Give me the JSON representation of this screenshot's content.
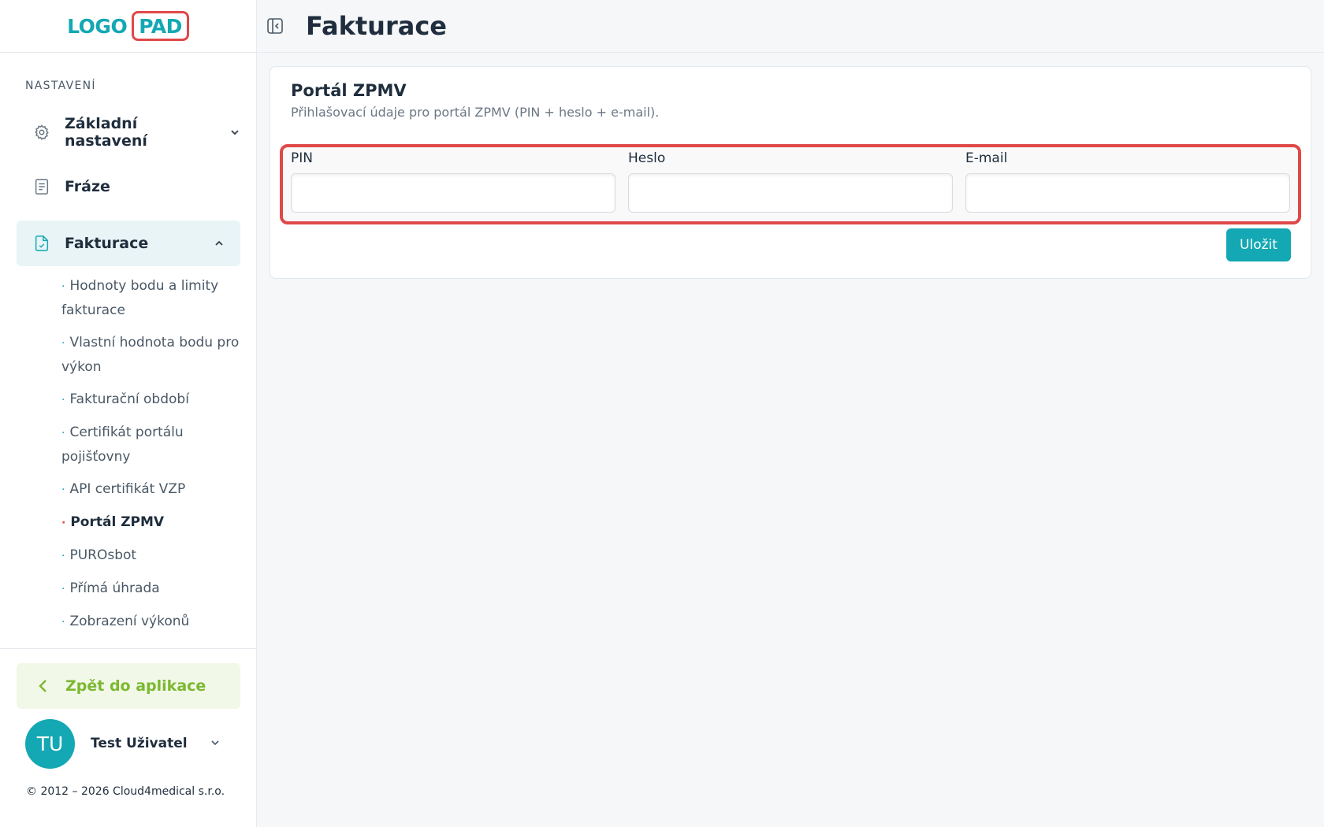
{
  "brand": {
    "logo_left": "LOGO",
    "logo_right": "PAD"
  },
  "sidebar": {
    "section_title": "NASTAVENÍ",
    "items": [
      {
        "label": "Základní nastavení",
        "icon": "gear-icon",
        "chevron": "chevron-down-icon"
      },
      {
        "label": "Fráze",
        "icon": "document-icon"
      },
      {
        "label": "Fakturace",
        "icon": "invoice-icon",
        "chevron": "chevron-up-icon",
        "active": true
      }
    ],
    "subitems": [
      "Hodnoty bodu a limity fakturace",
      "Vlastní hodnota bodu pro výkon",
      "Fakturační období",
      "Certifikát portálu pojišťovny",
      "API certifikát VZP",
      "Portál ZPMV",
      "PUROsbot",
      "Přímá úhrada",
      "Zobrazení výkonů"
    ],
    "current_subitem": "Portál ZPMV",
    "back_label": "Zpět do aplikace",
    "user": {
      "initials": "TU",
      "name": "Test Uživatel"
    },
    "copyright": "© 2012 – 2026 Cloud4medical s.r.o."
  },
  "header": {
    "title": "Fakturace"
  },
  "card": {
    "title": "Portál ZPMV",
    "subtitle": "Přihlašovací údaje pro portál ZPMV (PIN + heslo + e-mail).",
    "fields": [
      {
        "label": "PIN",
        "value": "",
        "placeholder": ""
      },
      {
        "label": "Heslo",
        "value": "",
        "placeholder": ""
      },
      {
        "label": "E-mail",
        "value": "",
        "placeholder": ""
      }
    ],
    "save_label": "Uložit"
  },
  "colors": {
    "accent": "#13a8b3",
    "highlight": "#e04848",
    "back_green": "#7cb82f",
    "active_bg": "#e8f4f6"
  }
}
